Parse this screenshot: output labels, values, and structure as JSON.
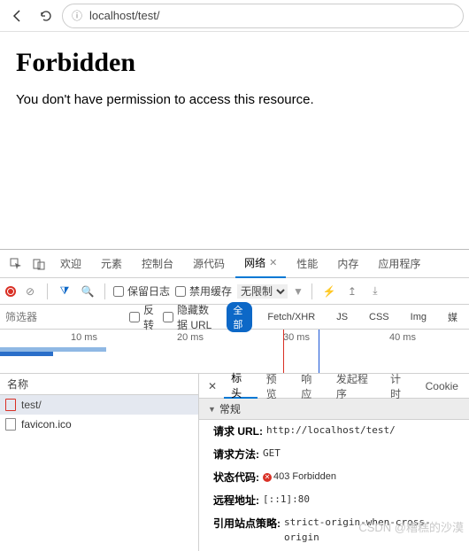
{
  "browser": {
    "url": "localhost/test/"
  },
  "page": {
    "heading": "Forbidden",
    "message": "You don't have permission to access this resource."
  },
  "devtools": {
    "tabs": [
      "欢迎",
      "元素",
      "控制台",
      "源代码",
      "网络",
      "性能",
      "内存",
      "应用程序"
    ],
    "active_tab": "网络",
    "network": {
      "preserve_log": "保留日志",
      "disable_cache": "禁用缓存",
      "throttling": "无限制",
      "filter_placeholder": "筛选器",
      "invert": "反转",
      "hide_data_urls": "隐藏数据 URL",
      "types": [
        "全部",
        "Fetch/XHR",
        "JS",
        "CSS",
        "Img",
        "媒"
      ],
      "active_type": "全部",
      "timeline_ticks": [
        "10 ms",
        "20 ms",
        "30 ms",
        "40 ms"
      ],
      "name_header": "名称",
      "requests": [
        {
          "name": "test/",
          "error": true
        },
        {
          "name": "favicon.ico",
          "error": false
        }
      ],
      "detail": {
        "tabs": [
          "标头",
          "预览",
          "响应",
          "发起程序",
          "计时",
          "Cookie"
        ],
        "active": "标头",
        "section": "常规",
        "rows": {
          "url_label": "请求 URL:",
          "url_value": "http://localhost/test/",
          "method_label": "请求方法:",
          "method_value": "GET",
          "status_label": "状态代码:",
          "status_value": "403 Forbidden",
          "remote_label": "远程地址:",
          "remote_value": "[::1]:80",
          "referrer_label": "引用站点策略:",
          "referrer_value": "strict-origin-when-cross-origin"
        }
      }
    }
  },
  "watermark": "CSDN @糟糕的沙漠"
}
